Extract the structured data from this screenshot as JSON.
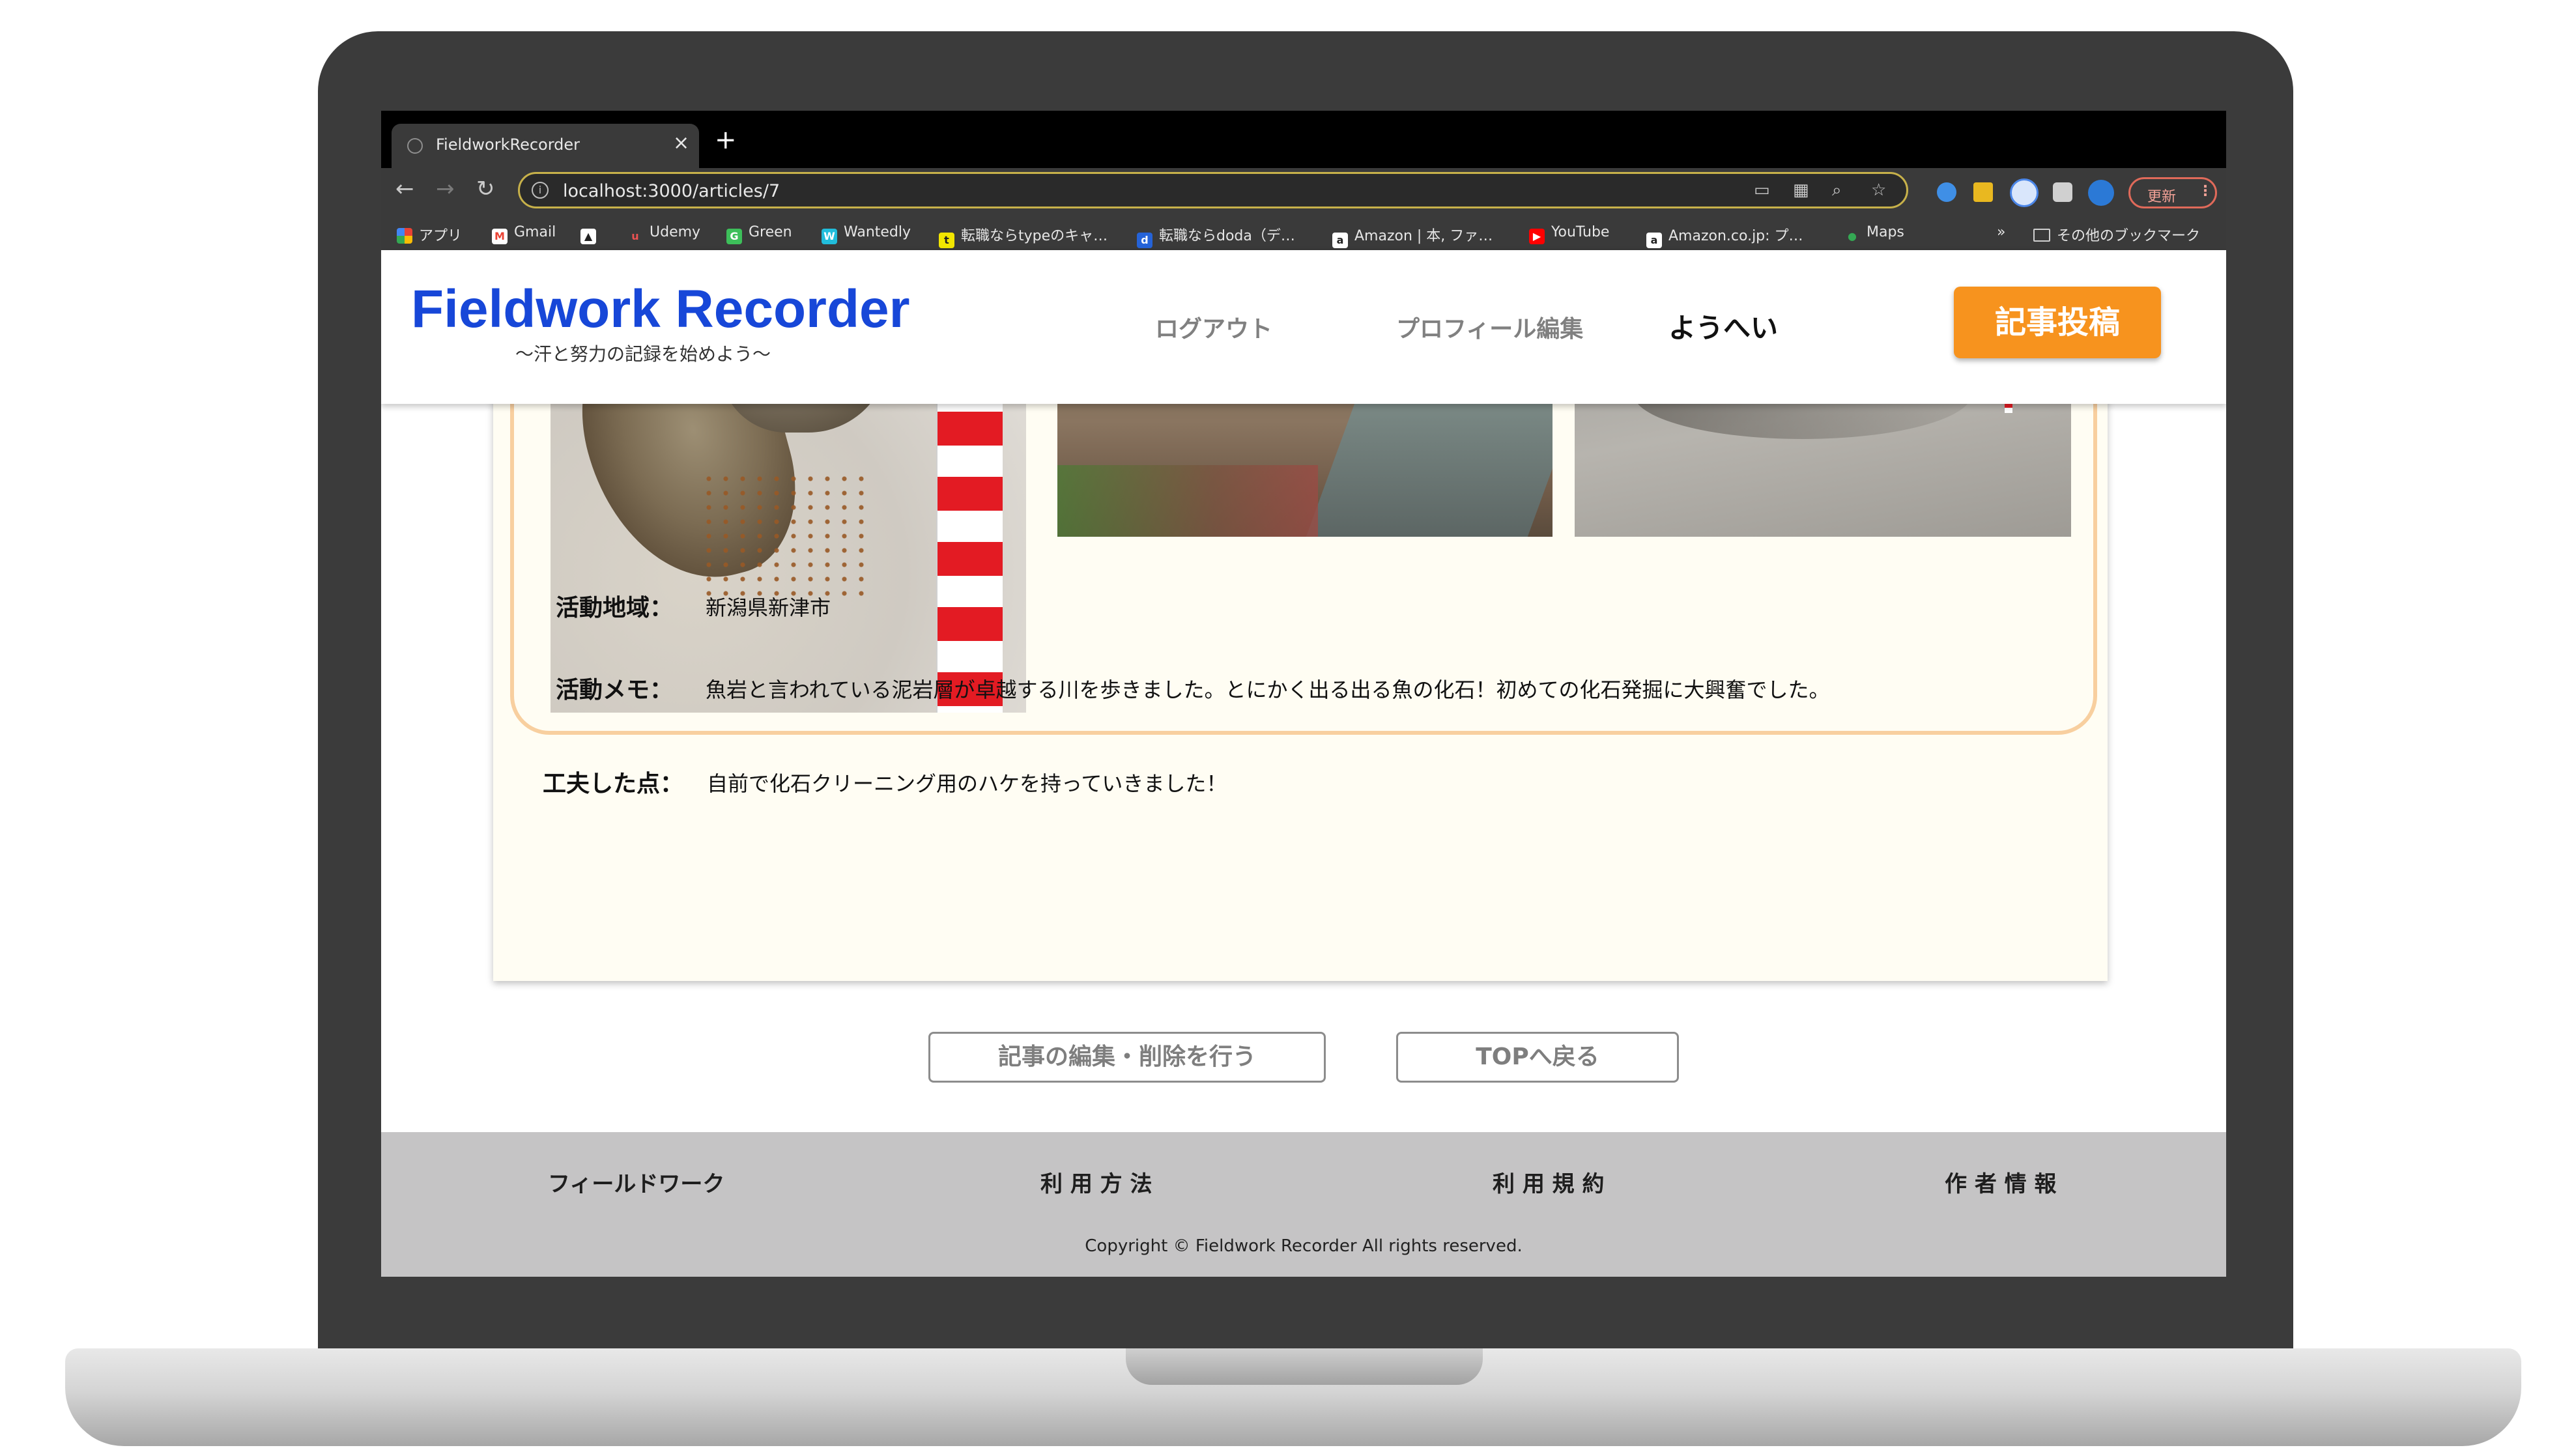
{
  "browser": {
    "tab_title": "FieldworkRecorder",
    "new_tab": "+",
    "url": "localhost:3000/articles/7",
    "update_label": "更新",
    "bookmarks": [
      {
        "label": "アプリ",
        "color": "#e94235",
        "icon": "apps-grid-icon"
      },
      {
        "label": "Gmail",
        "color": "#ea4335",
        "icon": "gmail-icon"
      },
      {
        "label": "",
        "color": "#ffffff",
        "icon": "atcoder-icon"
      },
      {
        "label": "Udemy",
        "color": "#a435f0",
        "icon": "udemy-icon"
      },
      {
        "label": "Green",
        "color": "#3dbf5a",
        "icon": "green-icon"
      },
      {
        "label": "Wantedly",
        "color": "#21bddb",
        "icon": "wantedly-icon"
      },
      {
        "label": "転職ならtypeのキャ…",
        "color": "#f2e600",
        "icon": "type-icon"
      },
      {
        "label": "転職ならdoda（デ…",
        "color": "#2563d8",
        "icon": "doda-icon"
      },
      {
        "label": "Amazon | 本, ファ…",
        "color": "#ffffff",
        "icon": "amazon-icon"
      },
      {
        "label": "YouTube",
        "color": "#ff0000",
        "icon": "youtube-icon"
      },
      {
        "label": "Amazon.co.jp: プ…",
        "color": "#ffffff",
        "icon": "amazon-icon"
      },
      {
        "label": "Maps",
        "color": "#34a853",
        "icon": "maps-icon"
      }
    ],
    "overflow": "»",
    "other_bookmarks": "その他のブックマーク"
  },
  "header": {
    "logo": "Fieldwork Recorder",
    "tagline": "〜汗と努力の記録を始めよう〜",
    "nav": [
      "ログアウト",
      "プロフィール編集",
      "ようへい"
    ],
    "post_button": "記事投稿"
  },
  "article": {
    "fields": [
      {
        "label": "活動地域：",
        "value": "新潟県新津市"
      },
      {
        "label": "活動メモ：",
        "value": "魚岩と言われている泥岩層が卓越する川を歩きました。とにかく出る出る魚の化石！初めての化石発掘に大興奮でした。"
      },
      {
        "label": "工夫した点：",
        "value": "自前で化石クリーニング用のハケを持っていきました！"
      }
    ]
  },
  "actions": {
    "edit": "記事の編集・削除を行う",
    "top": "TOPへ戻る"
  },
  "footer": {
    "links": [
      "フィールドワーク",
      "利 用 方 法",
      "利 用 規 約",
      "作 者 情 報"
    ],
    "copyright": "Copyright © Fieldwork Recorder All rights reserved."
  }
}
